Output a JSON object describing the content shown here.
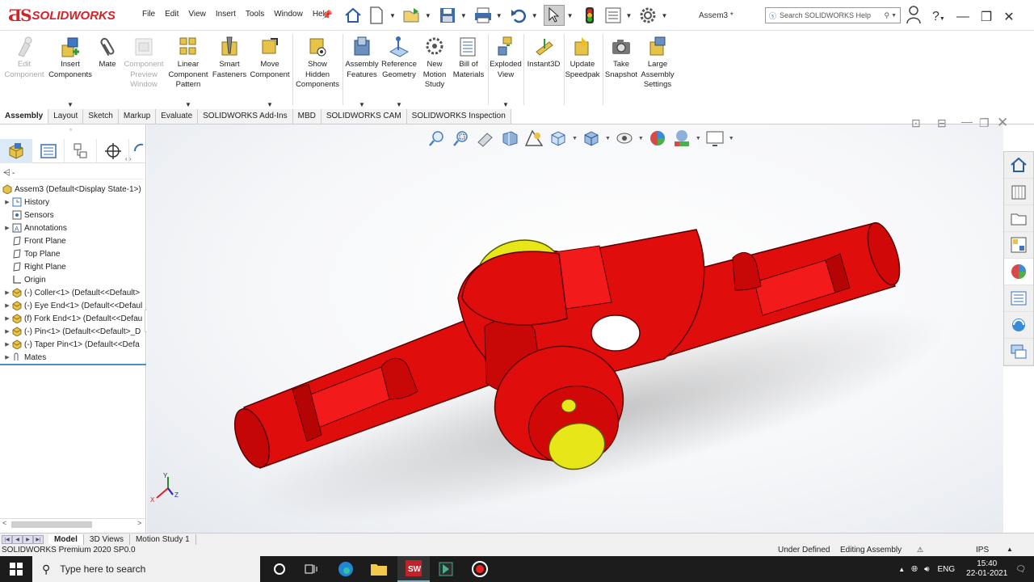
{
  "app": {
    "logo_text": "SOLIDWORKS",
    "document_name": "Assem3 *"
  },
  "menu": [
    "File",
    "Edit",
    "View",
    "Insert",
    "Tools",
    "Window",
    "Help"
  ],
  "search": {
    "placeholder": "Search SOLIDWORKS Help"
  },
  "command_manager": [
    {
      "label": "Edit\nComponent",
      "enabled": false
    },
    {
      "label": "Insert\nComponents",
      "enabled": true
    },
    {
      "label": "Mate",
      "enabled": true
    },
    {
      "label": "Component\nPreview\nWindow",
      "enabled": false
    },
    {
      "label": "Linear\nComponent\nPattern",
      "enabled": true
    },
    {
      "label": "Smart\nFasteners",
      "enabled": true
    },
    {
      "label": "Move\nComponent",
      "enabled": true
    },
    {
      "label": "Show\nHidden\nComponents",
      "enabled": true
    },
    {
      "label": "Assembly\nFeatures",
      "enabled": true
    },
    {
      "label": "Reference\nGeometry",
      "enabled": true
    },
    {
      "label": "New\nMotion\nStudy",
      "enabled": true
    },
    {
      "label": "Bill of\nMaterials",
      "enabled": true
    },
    {
      "label": "Exploded\nView",
      "enabled": true
    },
    {
      "label": "Instant3D",
      "enabled": true
    },
    {
      "label": "Update\nSpeedpak",
      "enabled": true
    },
    {
      "label": "Take\nSnapshot",
      "enabled": true
    },
    {
      "label": "Large\nAssembly\nSettings",
      "enabled": true
    }
  ],
  "tabs": [
    "Assembly",
    "Layout",
    "Sketch",
    "Markup",
    "Evaluate",
    "SOLIDWORKS Add-Ins",
    "MBD",
    "SOLIDWORKS CAM",
    "SOLIDWORKS Inspection"
  ],
  "tree": {
    "filter": "-",
    "items": [
      {
        "label": "Assem3  (Default<Display State-1>)",
        "icon": "assembly-icon",
        "expandable": false,
        "level": 0
      },
      {
        "label": "History",
        "icon": "history-icon",
        "expandable": true,
        "level": 1
      },
      {
        "label": "Sensors",
        "icon": "sensors-icon",
        "expandable": false,
        "level": 1
      },
      {
        "label": "Annotations",
        "icon": "annotations-icon",
        "expandable": true,
        "level": 1
      },
      {
        "label": "Front Plane",
        "icon": "plane-icon",
        "expandable": false,
        "level": 1
      },
      {
        "label": "Top Plane",
        "icon": "plane-icon",
        "expandable": false,
        "level": 1
      },
      {
        "label": "Right Plane",
        "icon": "plane-icon",
        "expandable": false,
        "level": 1
      },
      {
        "label": "Origin",
        "icon": "origin-icon",
        "expandable": false,
        "level": 1
      },
      {
        "label": "(-) Coller<1> (Default<<Default>",
        "icon": "part-icon",
        "expandable": true,
        "level": 1
      },
      {
        "label": "(-) Eye End<1> (Default<<Defaul",
        "icon": "part-icon",
        "expandable": true,
        "level": 1
      },
      {
        "label": "(f) Fork End<1> (Default<<Defau",
        "icon": "part-icon",
        "expandable": true,
        "level": 1
      },
      {
        "label": "(-) Pin<1> (Default<<Default>_D",
        "icon": "part-icon",
        "expandable": true,
        "level": 1
      },
      {
        "label": "(-) Taper Pin<1> (Default<<Defa",
        "icon": "part-icon",
        "expandable": true,
        "level": 1
      },
      {
        "label": "Mates",
        "icon": "mates-icon",
        "expandable": true,
        "level": 1
      }
    ]
  },
  "triad": {
    "x": "X",
    "y": "Y",
    "z": "Z"
  },
  "bottom_tabs": [
    "Model",
    "3D Views",
    "Motion Study 1"
  ],
  "status": {
    "product": "SOLIDWORKS Premium 2020 SP0.0",
    "state": "Under Defined",
    "mode": "Editing Assembly",
    "units": "IPS"
  },
  "taskbar": {
    "search_placeholder": "Type here to search",
    "language": "ENG",
    "time": "15:40",
    "date": "22-01-2021"
  },
  "colors": {
    "brand_red": "#d2232a",
    "part_red": "#e00d0d",
    "pin_yellow": "#e6e619",
    "selection_blue": "#4a90d0"
  }
}
